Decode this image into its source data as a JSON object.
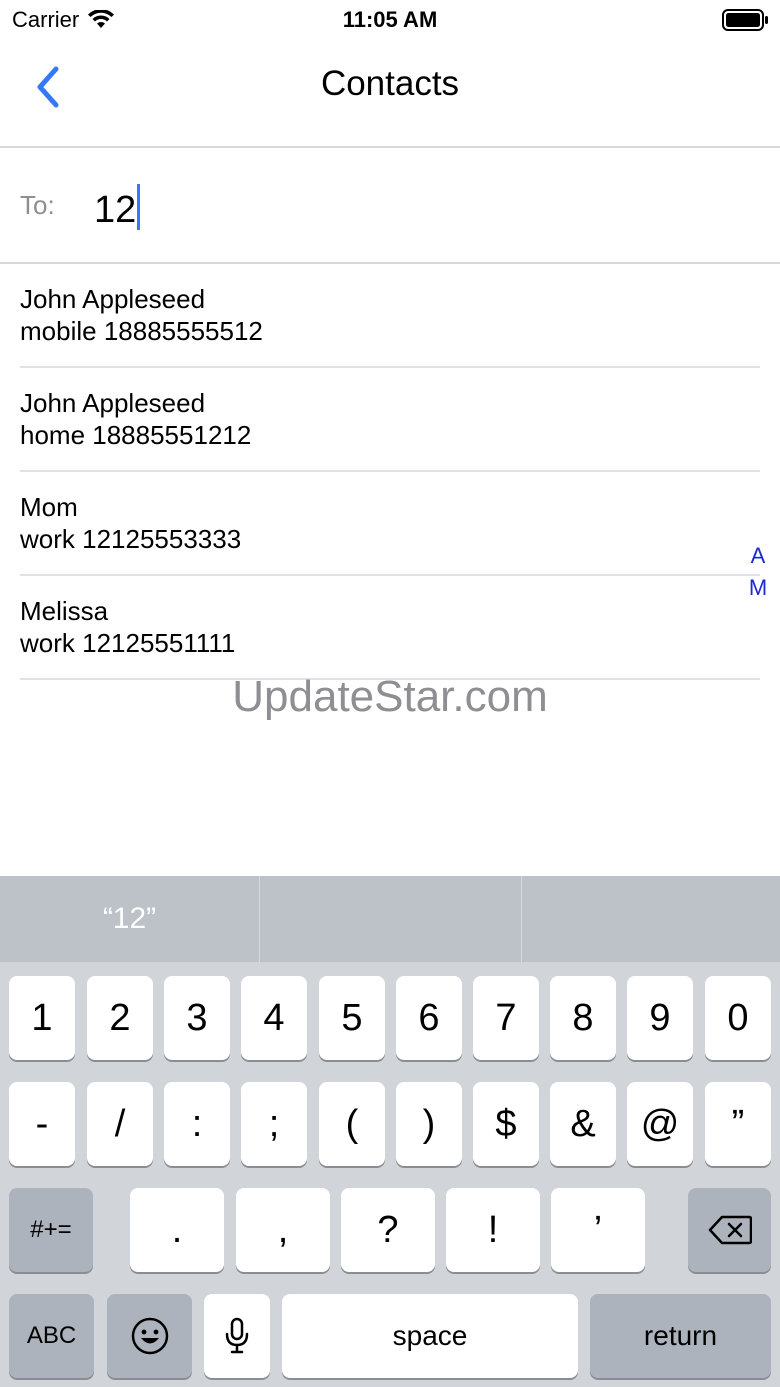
{
  "status_bar": {
    "carrier": "Carrier",
    "time": "11:05 AM"
  },
  "nav": {
    "title": "Contacts",
    "back_icon": "chevron-left-icon"
  },
  "recipient": {
    "label": "To:",
    "value": "12"
  },
  "results": [
    {
      "name": "John Appleseed",
      "detail": "mobile 18885555512"
    },
    {
      "name": "John Appleseed",
      "detail": "home 18885551212"
    },
    {
      "name": "Mom",
      "detail": "work 12125553333"
    },
    {
      "name": "Melissa",
      "detail": "work 12125551111"
    }
  ],
  "section_index": [
    "A",
    "M"
  ],
  "watermark": "UpdateStar.com",
  "keyboard": {
    "suggestions": [
      "“12”",
      "",
      ""
    ],
    "row1": [
      "1",
      "2",
      "3",
      "4",
      "5",
      "6",
      "7",
      "8",
      "9",
      "0"
    ],
    "row2": [
      "-",
      "/",
      ":",
      ";",
      "(",
      ")",
      "$",
      "&",
      "@",
      "”"
    ],
    "row3": [
      ".",
      ",",
      "?",
      "!",
      "’"
    ],
    "shift_label": "#+=",
    "abc_label": "ABC",
    "space_label": "space",
    "return_label": "return"
  },
  "colors": {
    "accent": "#3478f6",
    "index": "#1a2bd0",
    "keyboard_bg": "#d1d4d9"
  }
}
